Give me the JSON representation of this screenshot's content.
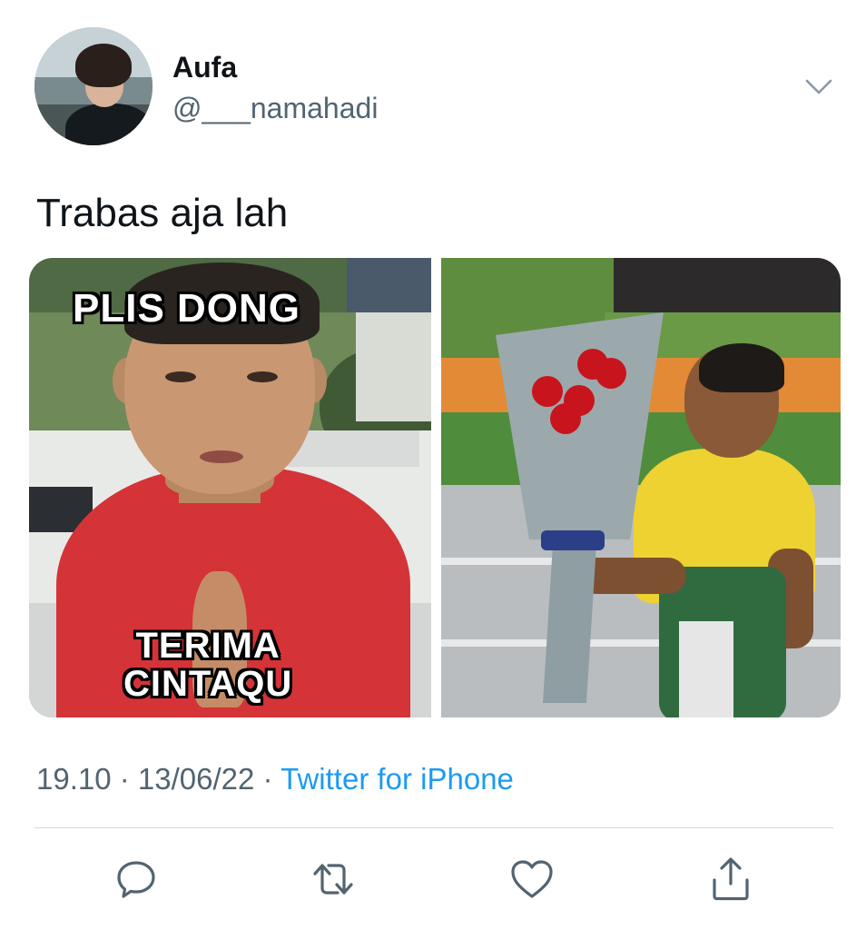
{
  "tweet": {
    "author": {
      "display_name": "Aufa",
      "handle": "@___namahadi",
      "avatar_icon": "profile-avatar"
    },
    "text": "Trabas aja lah",
    "media": {
      "left_image": {
        "caption_top": "PLIS DONG",
        "caption_bottom_line1": "TERIMA",
        "caption_bottom_line2": "CINTAQU"
      },
      "right_image": {
        "description_icon": "boy-with-bouquet"
      }
    },
    "meta": {
      "time": "19.10",
      "separator1": " · ",
      "date": "13/06/22",
      "separator2": " · ",
      "source": "Twitter for iPhone"
    },
    "actions": {
      "reply_icon": "reply-icon",
      "retweet_icon": "retweet-icon",
      "like_icon": "heart-icon",
      "share_icon": "share-icon"
    }
  },
  "colors": {
    "text_primary": "#0f1419",
    "text_secondary": "#536471",
    "accent": "#1d9bf0",
    "divider": "#cfd9de"
  }
}
